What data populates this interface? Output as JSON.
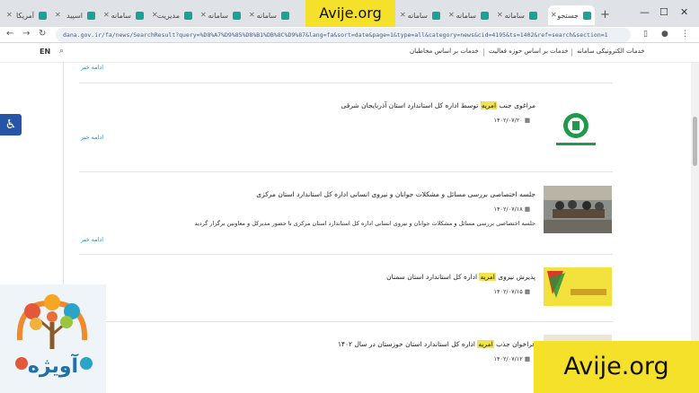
{
  "browser": {
    "tabs": [
      {
        "label": "آمریکا"
      },
      {
        "label": "اسپید"
      },
      {
        "label": "سامانه"
      },
      {
        "label": "مدیریت"
      },
      {
        "label": "سامانه"
      },
      {
        "label": "سامانه"
      },
      {
        "label": "سامانه"
      },
      {
        "label": "سامانه"
      },
      {
        "label": "سامانه"
      },
      {
        "label": "سامانه"
      },
      {
        "label": "سامانه"
      },
      {
        "label": "جستجو",
        "active": true
      }
    ],
    "new_tab": "+",
    "url": "dana.gov.ir/fa/news/SearchResult?query=%D8%A7%D9%85%D8%B1%DB%8C%D9%87&lang=fa&sort=date&page=1&type=all&category=news&cid=4195&ts=1402&ref=search&section=1"
  },
  "header": {
    "lang": "EN",
    "nav_links": [
      "خدمات الکترونیکی سامانه",
      "خدمات بر اساس حوزه فعالیت",
      "خدمات بر اساس مخاطبان"
    ]
  },
  "results": {
    "more_top": "ادامه خبر",
    "items": [
      {
        "title_before": "مراغوی جنب ",
        "highlight": "امریه",
        "title_after": " توسط اداره کل استاندارد استان آذربایجان شرقی",
        "date": "۱۴۰۲/۰۷/۲۰",
        "summary": "",
        "more": "ادامه خبر"
      },
      {
        "title_before": "جلسه اختصاصی بررسی مسائل و مشکلات جوانان و نیروی انسانی اداره کل استاندارد استان مرکزی",
        "highlight": "",
        "title_after": "",
        "date": "۱۴۰۲/۰۷/۱۸",
        "summary": "جلسه اختصاصی بررسی مسائل و مشکلات جوانان و نیروی انسانی اداره کل استاندارد استان مرکزی با حضور مدیرکل و معاونین برگزار گردید",
        "more": "ادامه خبر"
      },
      {
        "title_before": "پذیرش نیروی ",
        "highlight": "امریه",
        "title_after": " اداره کل استاندارد استان سمنان",
        "date": "۱۴۰۲/۰۷/۱۵",
        "summary": "",
        "more": ""
      },
      {
        "title_before": "فراخوان جذب ",
        "highlight": "امریه",
        "title_after": " اداره کل استاندارد استان خوزستان در سال ۱۴۰۲",
        "date": "۱۴۰۲/۰۷/۱۲",
        "summary": "",
        "more": ""
      }
    ]
  },
  "watermarks": {
    "top": "Avije.org",
    "bottom": "Avije.org",
    "logo_text": "آویژه"
  },
  "colors": {
    "accent_link": "#2b8fc9",
    "highlight": "#f1e34a",
    "watermark": "#f6e12a",
    "access_button": "#2655a8"
  }
}
